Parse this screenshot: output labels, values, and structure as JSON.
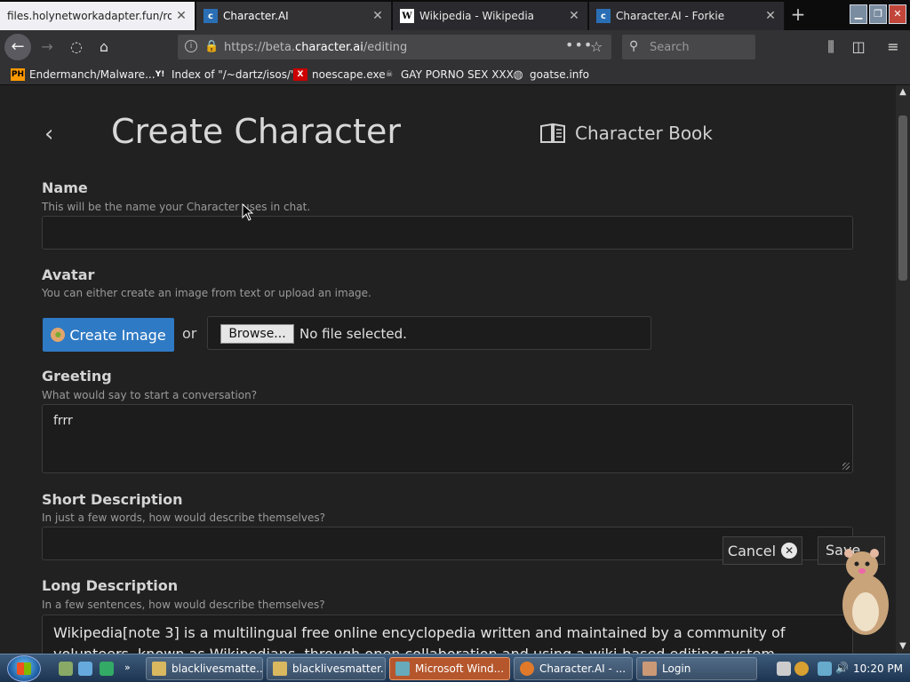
{
  "browser": {
    "tabs": [
      {
        "title": "files.holynetworkadapter.fun/rom",
        "favicon": "page-icon"
      },
      {
        "title": "Character.AI",
        "favicon": "characterai-icon"
      },
      {
        "title": "Wikipedia - Wikipedia",
        "favicon": "wikipedia-icon"
      },
      {
        "title": "Character.AI - Forkie",
        "favicon": "characterai-icon"
      }
    ],
    "url_prefix": "https://beta.",
    "url_domain": "character.ai",
    "url_path": "/editing",
    "search_placeholder": "Search",
    "bookmarks": [
      {
        "label": "Endermanch/Malware...",
        "icon_text": "PH"
      },
      {
        "label": "Index of \"/~dartz/isos/\"",
        "icon_text": "Y!"
      },
      {
        "label": "noescape.exe",
        "icon_text": "X"
      },
      {
        "label": "GAY PORNO SEX XXX",
        "icon_text": ""
      },
      {
        "label": "goatse.info",
        "icon_text": ""
      }
    ]
  },
  "page": {
    "title": "Create Character",
    "character_book": "Character Book",
    "name": {
      "label": "Name",
      "hint": "This will be the name your Character uses in chat.",
      "value": ""
    },
    "avatar": {
      "label": "Avatar",
      "hint": "You can either create an image from text or upload an image.",
      "create_label": "Create Image",
      "or": "or",
      "browse_label": "Browse...",
      "file_status": "No file selected."
    },
    "greeting": {
      "label": "Greeting",
      "hint": "What would say to start a conversation?",
      "value": "frrr"
    },
    "short_description": {
      "label": "Short Description",
      "hint": "In just a few words, how would describe themselves?",
      "value": ""
    },
    "long_description": {
      "label": "Long Description",
      "hint": "In a few sentences, how would describe themselves?",
      "value": "Wikipedia[note 3] is a multilingual free online encyclopedia written and maintained by a community of volunteers, known as Wikipedians, through open collaboration and using a wiki-based editing system. Wikipedia is the largest"
    },
    "cancel_label": "Cancel",
    "save_label": "Save"
  },
  "taskbar": {
    "items": [
      {
        "label": "blacklivesmatte...",
        "active": false
      },
      {
        "label": "blacklivesmatter...",
        "active": false
      },
      {
        "label": "Microsoft Wind...",
        "active": true
      },
      {
        "label": "Character.AI - ...",
        "active": false
      },
      {
        "label": "Login",
        "active": false
      }
    ],
    "clock": "10:20 PM"
  },
  "colors": {
    "accent": "#2f7ac4",
    "background": "#212121",
    "active_task": "#b5562c"
  }
}
